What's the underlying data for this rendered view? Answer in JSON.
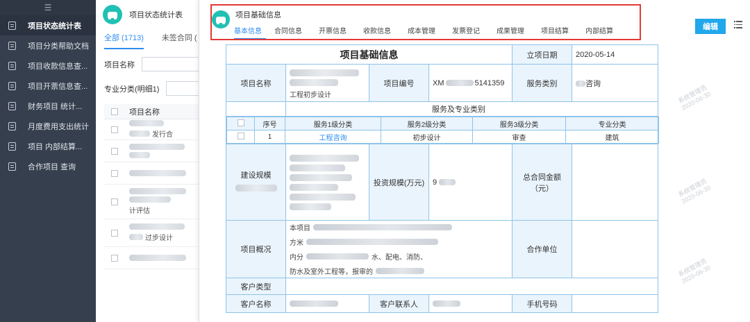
{
  "sidebar": {
    "items": [
      {
        "label": "项目状态统计表",
        "active": true
      },
      {
        "label": "项目分类帮助文档"
      },
      {
        "label": "项目收款信息查..."
      },
      {
        "label": "项目开票信息查..."
      },
      {
        "label": "财务项目 统计..."
      },
      {
        "label": "月度费用支出统计"
      },
      {
        "label": "项目 内部结算..."
      },
      {
        "label": "合作项目 查询"
      }
    ]
  },
  "list_page": {
    "title": "项目状态统计表",
    "tabs": [
      "全部 (1713)",
      "未签合同 ("
    ],
    "filters": {
      "project_name": "项目名称",
      "category": "专业分类(明细1)"
    },
    "list_header": "项目名称",
    "visible_row_text": [
      "发行合",
      "计评估",
      "过步设计"
    ]
  },
  "modal": {
    "title": "项目基础信息",
    "tabs": [
      "基本信息",
      "合同信息",
      "开票信息",
      "收款信息",
      "成本管理",
      "发票登记",
      "成果管理",
      "项目结算",
      "内部结算"
    ],
    "edit_label": "编辑",
    "watermark_user": "系统管理员",
    "watermark_date": "2020-06-30",
    "watermark_time": "18:09:55"
  },
  "info": {
    "heading": "项目基础信息",
    "setup_date_label": "立项日期",
    "setup_date": "2020-05-14",
    "project_name_label": "项目名称",
    "project_name_suffix": "工程初步设计",
    "project_no_label": "项目编号",
    "project_no_prefix": "XM",
    "project_no_suffix": "5141359",
    "service_type_label": "服务类别",
    "service_type_suffix": "咨询",
    "service_section_label": "服务及专业类别",
    "service_cols": [
      "序号",
      "服务1级分类",
      "服务2级分类",
      "服务3级分类",
      "专业分类"
    ],
    "service_row": {
      "index": "1",
      "level1": "工程咨询",
      "level2": "初步设计",
      "level3": "审查",
      "major": "建筑"
    },
    "scale_label": "建设规模",
    "invest_label": "投资规模(万元)",
    "invest_value": "9",
    "contract_total_label": "总合同金额（元）",
    "overview_label": "项目概况",
    "overview_lines": [
      "本项目",
      "方米",
      "内分",
      "防水及室外工程等，报审的"
    ],
    "overview_mid": "水、配电、消防、",
    "partner_label": "合作单位",
    "customer_type_label": "客户类型",
    "customer_name_label": "客户名称",
    "customer_contact_label": "客户联系人",
    "phone_label": "手机号码"
  }
}
